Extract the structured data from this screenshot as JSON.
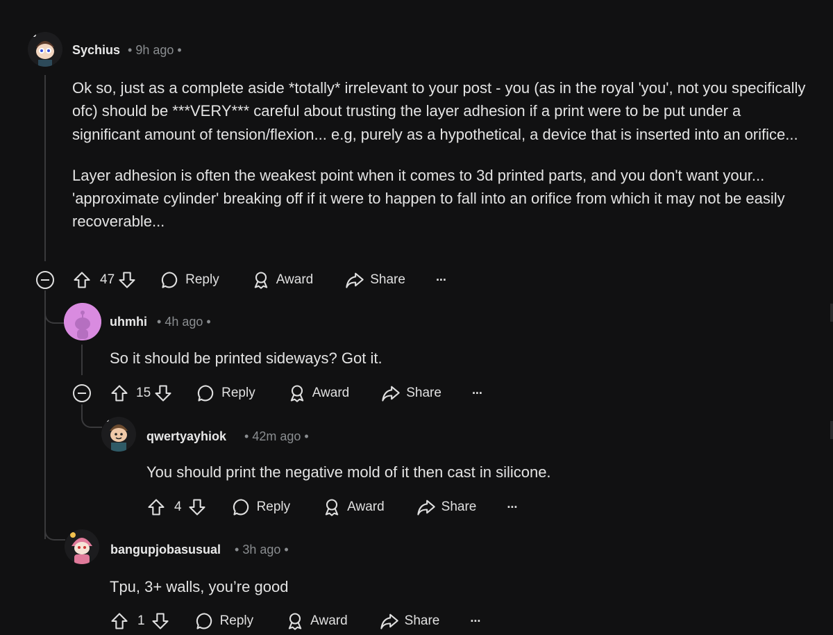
{
  "comments": [
    {
      "username": "Sychius",
      "time": "9h ago",
      "paragraphs": [
        "Ok so, just as a complete aside *totally* irrelevant to your post - you (as in the royal 'you', not you specifically ofc) should be ***VERY*** careful about trusting the layer adhesion if a print were to be put under a significant amount of tension/flexion... e.g, purely as a hypothetical, a device that is inserted into an orifice...",
        "Layer adhesion is often the weakest point when it comes to 3d printed parts, and you don't want your... 'approximate cylinder' breaking off if it were to happen to fall into an orifice from which it may not be easily recoverable..."
      ],
      "votes": "47"
    },
    {
      "username": "uhmhi",
      "time": "4h ago",
      "paragraphs": [
        "So it should be printed sideways? Got it."
      ],
      "votes": "15"
    },
    {
      "username": "qwertyayhiok",
      "time": "42m ago",
      "paragraphs": [
        "You should print the negative mold of it then cast in silicone."
      ],
      "votes": "4"
    },
    {
      "username": "bangupjobasusual",
      "time": "3h ago",
      "paragraphs": [
        "Tpu, 3+ walls, you’re good"
      ],
      "votes": "1"
    }
  ],
  "labels": {
    "reply": "Reply",
    "award": "Award",
    "share": "Share",
    "more": "···"
  },
  "colors": {
    "background": "#111112",
    "text": "#e4e4e4",
    "meta": "#8a8d90",
    "thread_line": "#3a3a3c",
    "avatar_uhmhi": "#d98be0"
  },
  "icons": [
    "minus-circle-icon",
    "upvote-icon",
    "downvote-icon",
    "comment-icon",
    "award-icon",
    "share-icon",
    "more-icon"
  ]
}
